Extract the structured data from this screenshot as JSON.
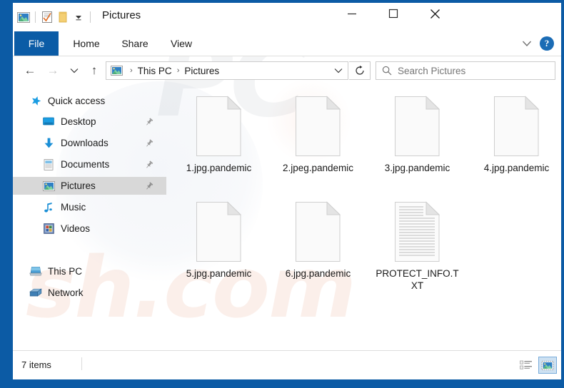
{
  "window": {
    "title": "Pictures",
    "border_color": "#0c5ba5",
    "quick_access_toolbar": [
      {
        "name": "pictures-folder-icon",
        "label": "Pictures"
      },
      {
        "name": "properties-icon",
        "label": "Properties"
      },
      {
        "name": "new-folder-icon",
        "label": "New folder"
      },
      {
        "name": "customize-dropdown-icon",
        "label": "Customize Quick Access Toolbar"
      }
    ],
    "controls": {
      "minimize": "—",
      "maximize": "☐",
      "close": "✕"
    }
  },
  "ribbon": {
    "tabs": [
      {
        "label": "File",
        "active": true
      },
      {
        "label": "Home",
        "active": false
      },
      {
        "label": "Share",
        "active": false
      },
      {
        "label": "View",
        "active": false
      }
    ],
    "collapse_icon": "chevron-down-icon",
    "help_label": "?",
    "accent_color": "#0b5ca6"
  },
  "navigation": {
    "back_icon": "←",
    "forward_icon": "→",
    "recent_icon": "⌄",
    "up_icon": "↑",
    "refresh_icon": "↻",
    "dropdown_icon": "⌄",
    "breadcrumbs": [
      "This PC",
      "Pictures"
    ],
    "breadcrumb_separator": "›"
  },
  "search": {
    "placeholder": "Search Pictures",
    "icon": "search-icon"
  },
  "sidebar": {
    "items": [
      {
        "label": "Quick access",
        "icon": "star-icon",
        "pinned": false,
        "selected": false,
        "indent": 0
      },
      {
        "label": "Desktop",
        "icon": "desktop-icon",
        "pinned": true,
        "selected": false,
        "indent": 1
      },
      {
        "label": "Downloads",
        "icon": "downloads-icon",
        "pinned": true,
        "selected": false,
        "indent": 1
      },
      {
        "label": "Documents",
        "icon": "documents-icon",
        "pinned": true,
        "selected": false,
        "indent": 1
      },
      {
        "label": "Pictures",
        "icon": "pictures-icon",
        "pinned": true,
        "selected": true,
        "indent": 1
      },
      {
        "label": "Music",
        "icon": "music-icon",
        "pinned": false,
        "selected": false,
        "indent": 1
      },
      {
        "label": "Videos",
        "icon": "videos-icon",
        "pinned": false,
        "selected": false,
        "indent": 1
      },
      {
        "label": "This PC",
        "icon": "this-pc-icon",
        "pinned": false,
        "selected": false,
        "indent": 0
      },
      {
        "label": "Network",
        "icon": "network-icon",
        "pinned": false,
        "selected": false,
        "indent": 0
      }
    ]
  },
  "files": [
    {
      "name": "1.jpg.pandemic",
      "icon": "blank-file-icon"
    },
    {
      "name": "2.jpeg.pandemic",
      "icon": "blank-file-icon"
    },
    {
      "name": "3.jpg.pandemic",
      "icon": "blank-file-icon"
    },
    {
      "name": "4.jpg.pandemic",
      "icon": "blank-file-icon"
    },
    {
      "name": "5.jpg.pandemic",
      "icon": "blank-file-icon"
    },
    {
      "name": "6.jpg.pandemic",
      "icon": "blank-file-icon"
    },
    {
      "name": "PROTECT_INFO.TXT",
      "icon": "text-file-icon"
    }
  ],
  "statusbar": {
    "item_count": "7 items",
    "view_buttons": [
      {
        "name": "details-view-button",
        "selected": false
      },
      {
        "name": "large-icons-view-button",
        "selected": true
      }
    ]
  },
  "watermark": {
    "top_text": "PC",
    "bottom_text": "sh.com"
  }
}
